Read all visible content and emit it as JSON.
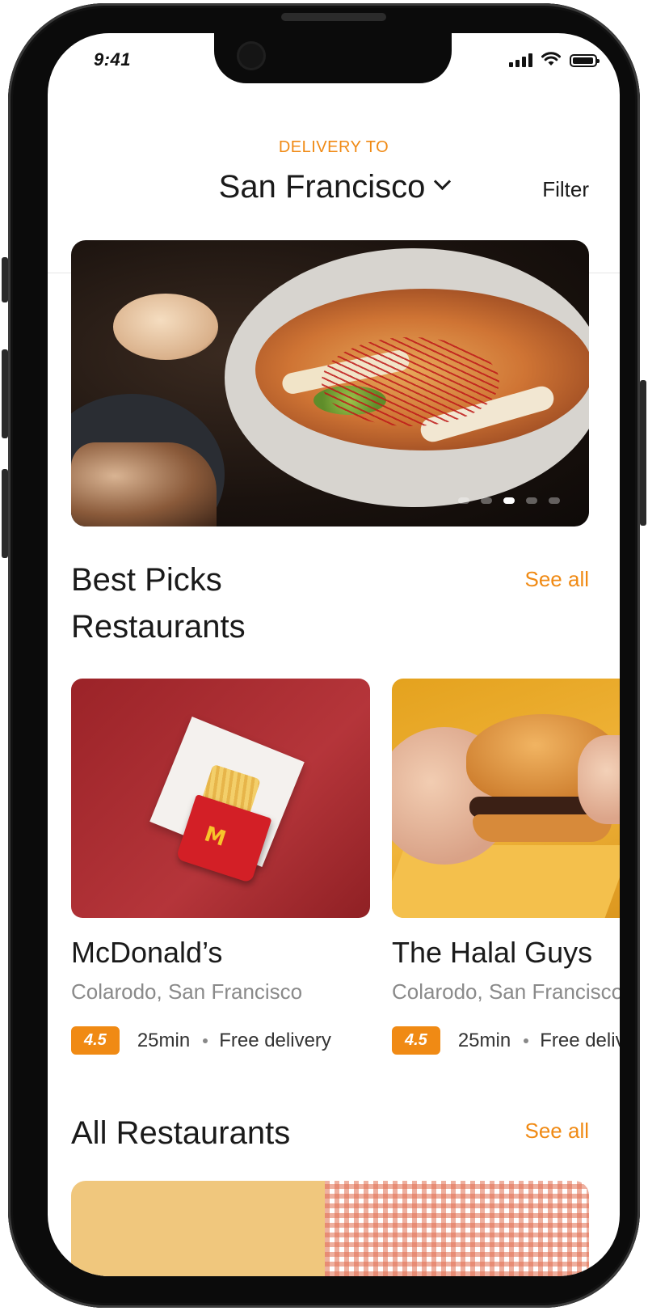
{
  "status_bar": {
    "time": "9:41"
  },
  "header": {
    "delivery_label": "DELIVERY TO",
    "location": "San Francisco",
    "filter_label": "Filter"
  },
  "banner": {
    "active_slide": 3,
    "slide_count": 5
  },
  "best_picks": {
    "title_line1": "Best Picks",
    "title_line2": "Restaurants",
    "see_all": "See all",
    "restaurants": [
      {
        "name": "McDonald’s",
        "address": "Colarodo, San Francisco",
        "rating": "4.5",
        "time": "25min",
        "delivery": "Free delivery"
      },
      {
        "name": "The Halal Guys",
        "address": "Colarodo, San Francisco",
        "rating": "4.5",
        "time": "25min",
        "delivery": "Free delivery"
      }
    ]
  },
  "all_restaurants": {
    "title": "All Restaurants",
    "see_all": "See all"
  },
  "colors": {
    "accent": "#f08a14",
    "text": "#1a1a1a",
    "muted": "#8a8a8a"
  },
  "icons": [
    "chevron-down-icon",
    "signal-icon",
    "wifi-icon",
    "battery-icon"
  ]
}
